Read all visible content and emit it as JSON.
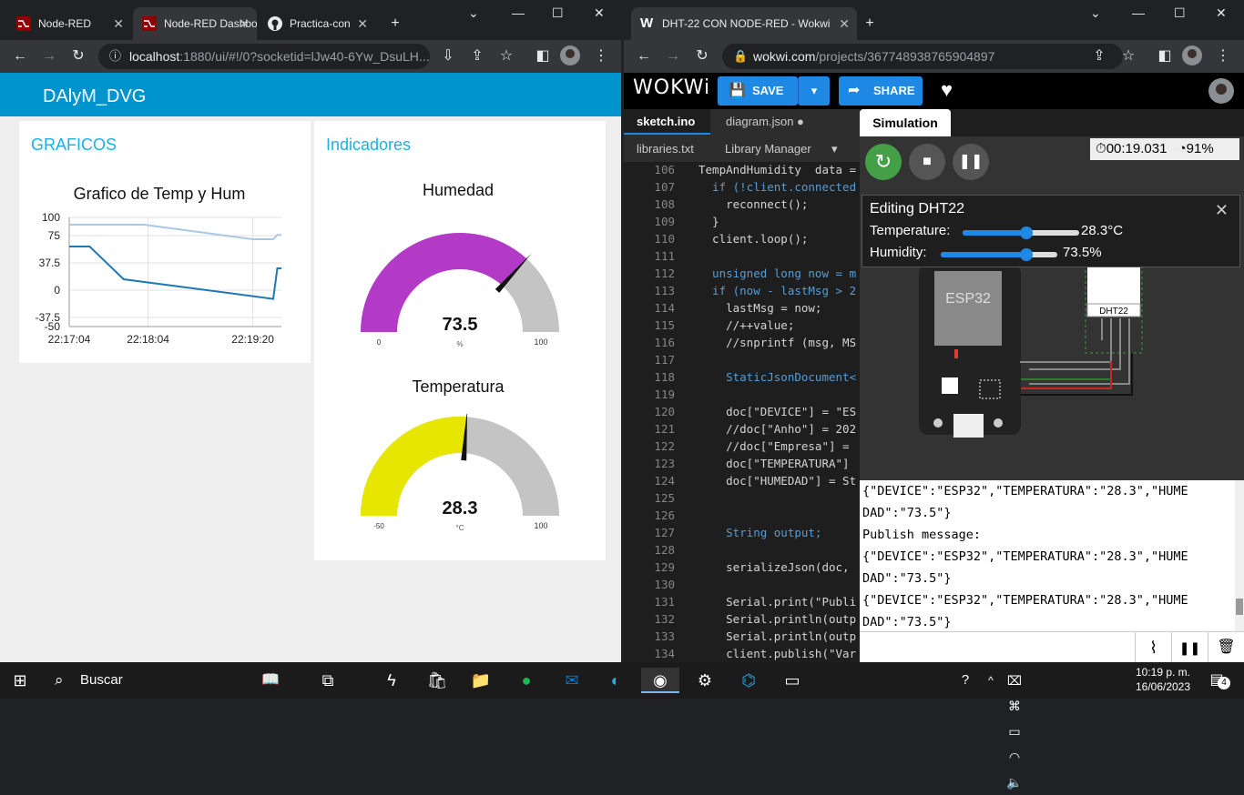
{
  "left_browser": {
    "tabs": [
      {
        "title": "Node-RED"
      },
      {
        "title": "Node-RED Dashboard"
      },
      {
        "title": "Practica-con"
      }
    ],
    "url": "localhost",
    "url_rest": ":1880/ui/#!/0?socketid=lJw40-6Yw_DsuLH..."
  },
  "dashboard": {
    "title": "DAlyM_DVG",
    "groups": {
      "graficos": "GRAFICOS",
      "indicadores": "Indicadores"
    },
    "chart": {
      "title": "Grafico de Temp y Hum",
      "yticks": [
        "100",
        "75",
        "37.5",
        "0",
        "-37.5",
        "-50"
      ],
      "xticks": [
        "22:17:04",
        "22:18:04",
        "22:19:20"
      ]
    },
    "gauge_hum": {
      "title": "Humedad",
      "value": "73.5",
      "unit": "%",
      "min": "0",
      "max": "100",
      "level": 0.735,
      "color": "#b23ac7"
    },
    "gauge_temp": {
      "title": "Temperatura",
      "value": "28.3",
      "unit": "°C",
      "min": "-50",
      "max": "100",
      "level": 0.522,
      "color": "#e6e600"
    }
  },
  "chart_data": {
    "type": "line",
    "title": "Grafico de Temp y Hum",
    "xlabel": "",
    "ylabel": "",
    "x_ticks": [
      "22:17:04",
      "22:18:04",
      "22:19:20"
    ],
    "ylim": [
      -50,
      100
    ],
    "grid": true,
    "series": [
      {
        "values": [
          [
            0,
            90
          ],
          [
            55,
            90
          ],
          [
            135,
            70
          ],
          [
            150,
            70
          ],
          [
            153,
            76
          ],
          [
            156,
            76
          ]
        ],
        "color": "#a9c8e8"
      },
      {
        "values": [
          [
            0,
            60
          ],
          [
            15,
            60
          ],
          [
            40,
            15
          ],
          [
            150,
            -12
          ],
          [
            153,
            30
          ],
          [
            156,
            30
          ]
        ],
        "color": "#1f77b4"
      }
    ]
  },
  "right_browser": {
    "tab": "DHT-22 CON NODE-RED - Wokwi",
    "url": "wokwi.com",
    "url_rest": "/projects/367748938765904897"
  },
  "wokwi": {
    "logo": "WOKWi",
    "save": "SAVE",
    "share": "SHARE",
    "tabs": [
      "sketch.ino",
      "diagram.json ●",
      "libraries.txt",
      "Library Manager"
    ],
    "sim_tab": "Simulation",
    "timer": "00:19.031",
    "speed": "91%",
    "editing": {
      "title": "Editing DHT22",
      "temp_label": "Temperature:",
      "temp_value": "28.3°C",
      "temp_level": 0.55,
      "hum_label": "Humidity:",
      "hum_value": "73.5%",
      "hum_level": 0.735
    },
    "chips": {
      "esp": "ESP32",
      "dht": "DHT22"
    },
    "code": [
      {
        "n": "106",
        "t": "TempAndHumidity  data ="
      },
      {
        "n": "107",
        "t": "  if (!client.connected"
      },
      {
        "n": "108",
        "t": "    reconnect();"
      },
      {
        "n": "109",
        "t": "  }"
      },
      {
        "n": "110",
        "t": "  client.loop();"
      },
      {
        "n": "111",
        "t": ""
      },
      {
        "n": "112",
        "t": "  unsigned long now = m"
      },
      {
        "n": "113",
        "t": "  if (now - lastMsg > 2"
      },
      {
        "n": "114",
        "t": "    lastMsg = now;"
      },
      {
        "n": "115",
        "t": "    //++value;"
      },
      {
        "n": "116",
        "t": "    //snprintf (msg, MS"
      },
      {
        "n": "117",
        "t": ""
      },
      {
        "n": "118",
        "t": "    StaticJsonDocument<"
      },
      {
        "n": "119",
        "t": ""
      },
      {
        "n": "120",
        "t": "    doc[\"DEVICE\"] = \"ES"
      },
      {
        "n": "121",
        "t": "    //doc[\"Anho\"] = 202"
      },
      {
        "n": "122",
        "t": "    //doc[\"Empresa\"] ="
      },
      {
        "n": "123",
        "t": "    doc[\"TEMPERATURA\"]"
      },
      {
        "n": "124",
        "t": "    doc[\"HUMEDAD\"] = St"
      },
      {
        "n": "125",
        "t": ""
      },
      {
        "n": "126",
        "t": ""
      },
      {
        "n": "127",
        "t": "    String output;"
      },
      {
        "n": "128",
        "t": ""
      },
      {
        "n": "129",
        "t": "    serializeJson(doc,"
      },
      {
        "n": "130",
        "t": ""
      },
      {
        "n": "131",
        "t": "    Serial.print(\"Publi"
      },
      {
        "n": "132",
        "t": "    Serial.println(outp"
      },
      {
        "n": "133",
        "t": "    Serial.println(outp"
      },
      {
        "n": "134",
        "t": "    client.publish(\"Var"
      }
    ],
    "serial": [
      "{\"DEVICE\":\"ESP32\",\"TEMPERATURA\":\"28.3\",\"HUME",
      "DAD\":\"73.5\"}",
      "Publish message:",
      "{\"DEVICE\":\"ESP32\",\"TEMPERATURA\":\"28.3\",\"HUME",
      "DAD\":\"73.5\"}",
      "{\"DEVICE\":\"ESP32\",\"TEMPERATURA\":\"28.3\",\"HUME",
      "DAD\":\"73.5\"}"
    ]
  },
  "taskbar": {
    "search": "Buscar",
    "time": "10:19 p. m.",
    "date": "16/06/2023",
    "notif": "4"
  }
}
